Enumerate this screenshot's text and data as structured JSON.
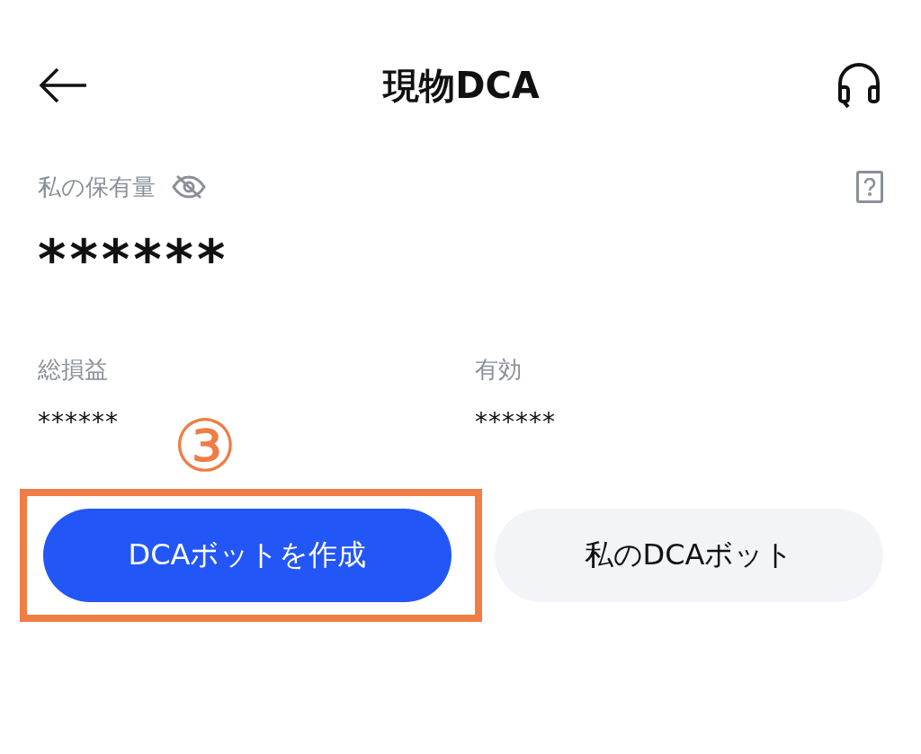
{
  "header": {
    "title": "現物DCA"
  },
  "holdings": {
    "label": "私の保有量",
    "value": "******"
  },
  "stats": [
    {
      "label": "総損益",
      "value": "******"
    },
    {
      "label": "有効",
      "value": "******"
    }
  ],
  "step_marker": "③",
  "buttons": [
    {
      "label": "DCAボットを作成",
      "kind": "primary",
      "highlighted": true
    },
    {
      "label": "私のDCAボット",
      "kind": "secondary",
      "highlighted": false
    }
  ]
}
